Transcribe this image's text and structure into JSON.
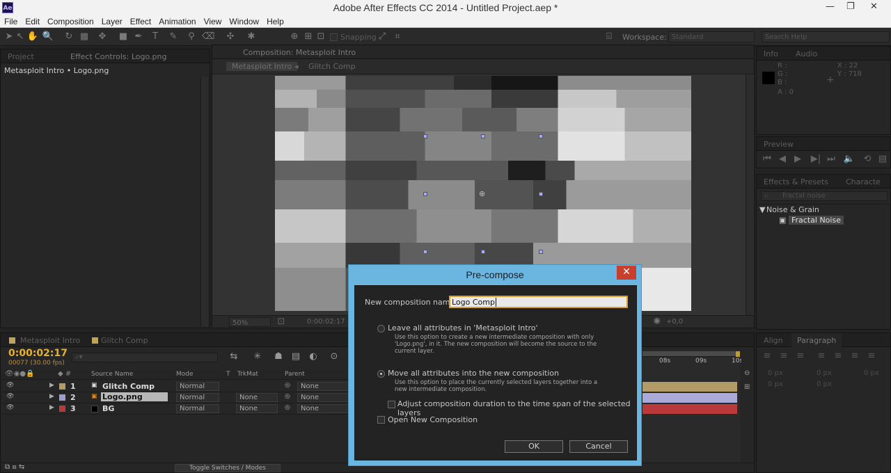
{
  "window": {
    "title": "Adobe After Effects CC 2014 - Untitled Project.aep *",
    "app_icon": "Ae"
  },
  "menu": [
    "File",
    "Edit",
    "Composition",
    "Layer",
    "Effect",
    "Animation",
    "View",
    "Window",
    "Help"
  ],
  "toolbar": {
    "snapping": "Snapping",
    "workspace_label": "Workspace:",
    "workspace_value": "Standard",
    "search_placeholder": "Search Help"
  },
  "left_panel": {
    "tab_project": "Project",
    "tab_effect_controls": "Effect Controls: Logo.png",
    "breadcrumb": "Metasploit Intro • Logo.png"
  },
  "composition_panel": {
    "tab_title": "Composition: Metasploit Intro",
    "crumb_1": "Metasploit Intro",
    "crumb_2": "Glitch Comp",
    "zoom": "50%",
    "timecode": "0:00:02:17",
    "exposure": "+0,0"
  },
  "info_panel": {
    "tab_info": "Info",
    "tab_audio": "Audio",
    "r": "R :",
    "g": "G :",
    "b": "B :",
    "a": "A : 0",
    "x": "X : 22",
    "y": "Y : 718"
  },
  "preview_panel": {
    "tab": "Preview"
  },
  "effects_panel": {
    "tab": "Effects & Presets",
    "tab2": "Characte",
    "search": "fractal noise",
    "category": "Noise & Grain",
    "item": "Fractal Noise"
  },
  "paragraph_panel": {
    "tab_align": "Align",
    "tab_paragraph": "Paragraph",
    "values": [
      "0 px",
      "0 px",
      "0 px",
      "0 px",
      "0 px"
    ]
  },
  "timeline": {
    "tab_1": "Metasploit Intro",
    "tab_2": "Glitch Comp",
    "timecode": "0:00:02:17",
    "frames": "00077 (30.00 fps)",
    "col_source": "Source Name",
    "col_mode": "Mode",
    "col_t": "T",
    "col_trkmat": "TrkMat",
    "col_parent": "Parent",
    "ruler": [
      "08s",
      "09s",
      "10s"
    ],
    "toggle_label": "Toggle Switches / Modes",
    "layers": [
      {
        "num": "1",
        "name": "Glitch Comp",
        "mode": "Normal",
        "trkmat": "",
        "parent": "None",
        "color": "#b39b66"
      },
      {
        "num": "2",
        "name": "Logo.png",
        "mode": "Normal",
        "trkmat": "None",
        "parent": "None",
        "color": "#9d9ecb"
      },
      {
        "num": "3",
        "name": "BG",
        "mode": "Normal",
        "trkmat": "None",
        "parent": "None",
        "color": "#b83a3a"
      }
    ]
  },
  "dialog": {
    "title": "Pre-compose",
    "name_label": "New composition name:",
    "name_value": "Logo Comp",
    "option1_label": "Leave all attributes in 'Metasploit Intro'",
    "option1_desc": "Use this option to create a new intermediate composition with only 'Logo.png', in it. The new composition will become the source to the current layer.",
    "option2_label": "Move all attributes into the new composition",
    "option2_desc": "Use this option to place the currently selected layers together into a new intermediate composition.",
    "adjust_label": "Adjust composition duration to the time span of the selected layers",
    "open_label": "Open New Composition",
    "ok": "OK",
    "cancel": "Cancel"
  }
}
